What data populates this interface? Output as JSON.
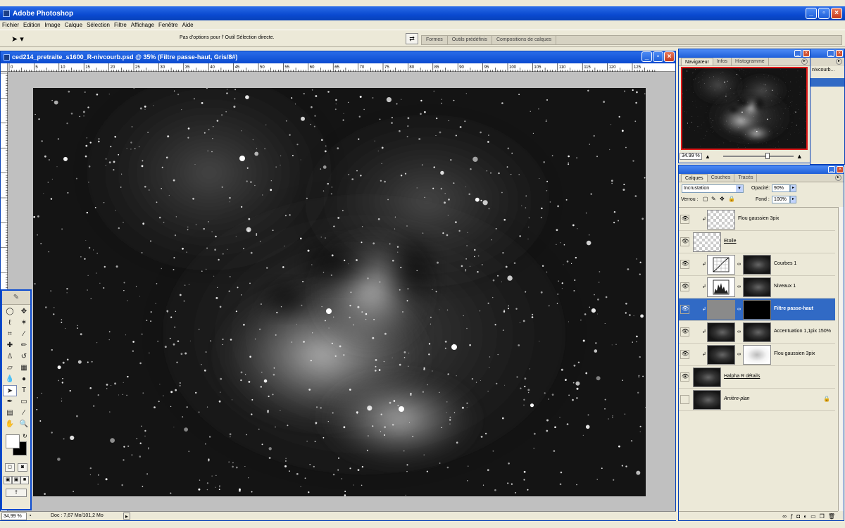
{
  "window": {
    "title": "Adobe Photoshop"
  },
  "menu": [
    "Fichier",
    "Edition",
    "Image",
    "Calque",
    "Sélection",
    "Filtre",
    "Affichage",
    "Fenêtre",
    "Aide"
  ],
  "options": {
    "tool_icon": "direct-selection-icon",
    "text": "Pas d'options pour l' Outil Sélection directe.",
    "well_tabs": [
      "Formes",
      "Outils prédéfinis",
      "Compositions de calques"
    ]
  },
  "document": {
    "title": "ced214_pretraite_s1600_R-nivcourb.psd @ 35% (Filtre passe-haut, Gris/8#)",
    "ruler_ticks": [
      "0",
      "5",
      "10",
      "15",
      "20",
      "25",
      "30",
      "35",
      "40",
      "45",
      "50",
      "55",
      "60",
      "65",
      "70",
      "75",
      "80",
      "85",
      "90",
      "95",
      "100",
      "105",
      "110",
      "115",
      "120",
      "125"
    ]
  },
  "status": {
    "zoom": "34,99 %",
    "doc": "Doc : 7,67 Mo/101,2 Mo"
  },
  "navigator": {
    "tabs": [
      "Navigateur",
      "Infos",
      "Histogramme"
    ],
    "zoom": "34.99 %",
    "slider_level_percent": 60
  },
  "background_panel": {
    "text": "nivcourb..."
  },
  "layers": {
    "tabs": [
      "Calques",
      "Couches",
      "Tracés"
    ],
    "blend_mode": "Incrustation",
    "opacity_label": "Opacité:",
    "opacity": "90%",
    "lock_label": "Verrou :",
    "fill_label": "Fond :",
    "fill": "100%",
    "items": [
      {
        "name": "Flou gaussien 3pix",
        "visible": true,
        "clipped": true,
        "thumb": "checker",
        "mask": null,
        "style": "normal"
      },
      {
        "name": "Etoile",
        "visible": true,
        "clipped": false,
        "thumb": "checker",
        "mask": null,
        "style": "underline"
      },
      {
        "name": "Courbes 1",
        "visible": true,
        "clipped": true,
        "thumb": "curves",
        "mask": "dark",
        "style": "normal"
      },
      {
        "name": "Niveaux 1",
        "visible": true,
        "clipped": true,
        "thumb": "levels",
        "mask": "dark",
        "style": "normal"
      },
      {
        "name": "Filtre passe-haut",
        "visible": true,
        "clipped": true,
        "thumb": "gray",
        "mask": "black",
        "style": "active"
      },
      {
        "name": "Accentuation 1,1pix 150%",
        "visible": true,
        "clipped": true,
        "thumb": "dark",
        "mask": "dark",
        "style": "normal"
      },
      {
        "name": "Flou gaussien 3pix",
        "visible": true,
        "clipped": true,
        "thumb": "dark",
        "mask": "softwhite",
        "style": "normal"
      },
      {
        "name": "Halpha R détails",
        "visible": true,
        "clipped": false,
        "thumb": "dark",
        "mask": null,
        "style": "underline"
      },
      {
        "name": "Arrière-plan",
        "visible": false,
        "clipped": false,
        "thumb": "dark",
        "mask": null,
        "style": "italic",
        "locked": true
      }
    ]
  }
}
